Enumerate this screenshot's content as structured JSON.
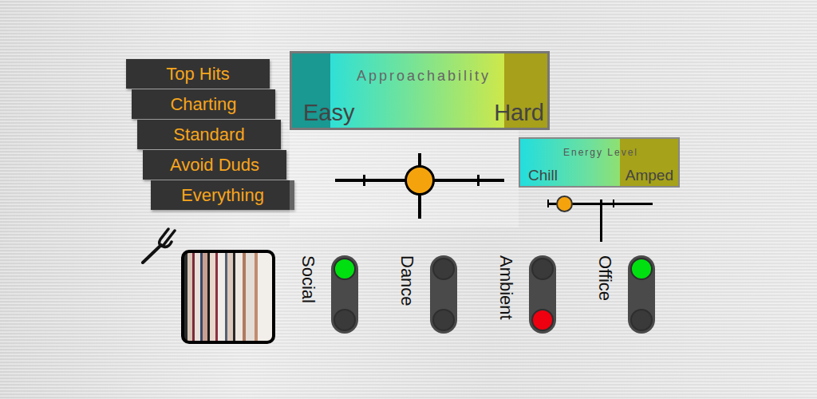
{
  "presets": [
    {
      "label": "Top Hits"
    },
    {
      "label": "Charting"
    },
    {
      "label": "Standard"
    },
    {
      "label": "Avoid Duds"
    },
    {
      "label": "Everything"
    }
  ],
  "approachability": {
    "title": "Approachability",
    "low": "Easy",
    "high": "Hard",
    "level": 0.5
  },
  "energy": {
    "title": "Energy Level",
    "low": "Chill",
    "high": "Amped",
    "level": 0.16
  },
  "moods": [
    {
      "label": "Social",
      "on": true,
      "off": false
    },
    {
      "label": "Dance",
      "on": false,
      "off": false
    },
    {
      "label": "Ambient",
      "on": false,
      "off": true
    },
    {
      "label": "Office",
      "on": true,
      "off": false
    }
  ]
}
